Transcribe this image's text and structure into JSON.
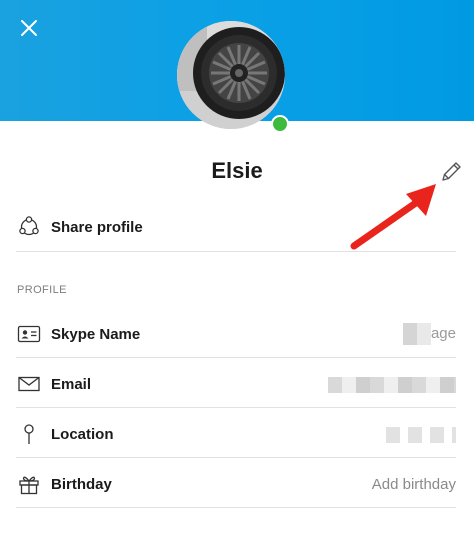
{
  "profile": {
    "display_name": "Elsie",
    "presence": "online",
    "presence_color": "#3dbb3d",
    "header_color": "#0aa0e6"
  },
  "actions": {
    "share_profile_label": "Share profile"
  },
  "section": {
    "title": "PROFILE"
  },
  "fields": {
    "skype_name": {
      "label": "Skype Name",
      "value_suffix": "age"
    },
    "email": {
      "label": "Email"
    },
    "location": {
      "label": "Location"
    },
    "birthday": {
      "label": "Birthday",
      "value": "Add birthday"
    }
  },
  "icons": {
    "close": "close-icon",
    "edit": "pencil-icon",
    "share": "share-icon",
    "skype_name": "id-card-icon",
    "email": "envelope-icon",
    "location": "map-pin-icon",
    "birthday": "gift-icon"
  },
  "annotation": {
    "arrow_color": "#e8241c"
  }
}
